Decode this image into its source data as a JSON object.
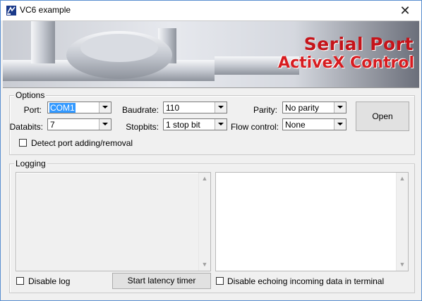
{
  "window": {
    "title": "VC6 example",
    "close_glyph": "✕"
  },
  "banner": {
    "line1": "Serial Port",
    "line2": "ActiveX Control",
    "accent_color": "#c5141a"
  },
  "options": {
    "legend": "Options",
    "port": {
      "label": "Port:",
      "value": "COM1"
    },
    "databits": {
      "label": "Databits:",
      "value": "7"
    },
    "baudrate": {
      "label": "Baudrate:",
      "value": "110"
    },
    "stopbits": {
      "label": "Stopbits:",
      "value": "1 stop bit"
    },
    "parity": {
      "label": "Parity:",
      "value": "No parity"
    },
    "flow": {
      "label": "Flow control:",
      "value": "None"
    },
    "open_label": "Open",
    "detect_label": "Detect port adding/removal",
    "detect_checked": false
  },
  "logging": {
    "legend": "Logging",
    "disable_log_label": "Disable log",
    "disable_log_checked": false,
    "latency_label": "Start latency timer",
    "disable_echo_label": "Disable echoing incoming data in terminal",
    "disable_echo_checked": false
  }
}
